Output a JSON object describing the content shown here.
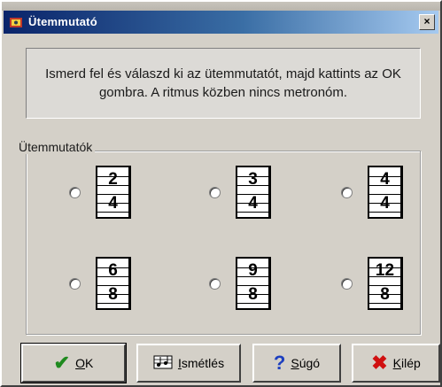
{
  "window": {
    "title": "Ütemmutató",
    "close_glyph": "×"
  },
  "instruction": {
    "text": "Ismerd fel és válaszd ki az ütemmutatót, majd kattints az OK gombra. A ritmus közben nincs metronóm."
  },
  "group": {
    "label": "Ütemmutatók"
  },
  "options": [
    {
      "top": "2",
      "bottom": "4",
      "selected": false
    },
    {
      "top": "3",
      "bottom": "4",
      "selected": false
    },
    {
      "top": "4",
      "bottom": "4",
      "selected": false
    },
    {
      "top": "6",
      "bottom": "8",
      "selected": false
    },
    {
      "top": "9",
      "bottom": "8",
      "selected": false
    },
    {
      "top": "12",
      "bottom": "8",
      "selected": false
    }
  ],
  "buttons": {
    "ok": {
      "mnemonic": "O",
      "rest": "K",
      "icon": "checkmark-icon",
      "icon_color": "#1f8a1f"
    },
    "repeat": {
      "mnemonic": "I",
      "rest": "smétlés",
      "icon": "repeat-notes-icon"
    },
    "help": {
      "mnemonic": "S",
      "rest": "úgó",
      "icon": "question-icon",
      "icon_color": "#1d3fbf"
    },
    "quit": {
      "mnemonic": "K",
      "rest": "ilép",
      "icon": "x-icon",
      "icon_color": "#d01010"
    }
  },
  "colors": {
    "title_start": "#0a246a",
    "title_end": "#a6caf0",
    "face": "#d4d0c8"
  }
}
